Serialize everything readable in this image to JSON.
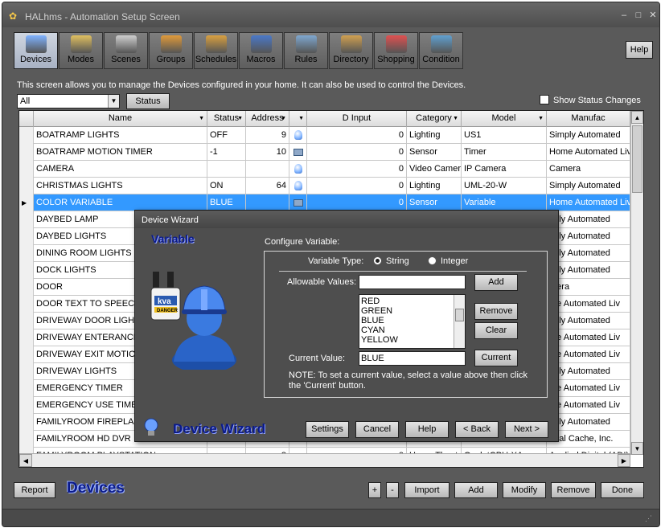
{
  "window": {
    "title": "HALhms - Automation Setup Screen",
    "controls": [
      "–",
      "□",
      "✕"
    ]
  },
  "toolbar": {
    "buttons": [
      {
        "label": "Devices",
        "icon": "bulb-icon",
        "color": "#7fb3ff"
      },
      {
        "label": "Modes",
        "icon": "house-icon",
        "color": "#e0c060"
      },
      {
        "label": "Scenes",
        "icon": "clapperboard-icon",
        "color": "#cfcfcf"
      },
      {
        "label": "Groups",
        "icon": "circles-icon",
        "color": "#e09a3a"
      },
      {
        "label": "Schedules",
        "icon": "calendar-icon",
        "color": "#d9a040"
      },
      {
        "label": "Macros",
        "icon": "funnel-icon",
        "color": "#4a78c8"
      },
      {
        "label": "Rules",
        "icon": "rules-icon",
        "color": "#7fa8d0"
      },
      {
        "label": "Directory",
        "icon": "people-icon",
        "color": "#d0a050"
      },
      {
        "label": "Shopping",
        "icon": "cart-icon",
        "color": "#e05050"
      },
      {
        "label": "Condition",
        "icon": "condition-icon",
        "color": "#60a0d0"
      }
    ],
    "help_label": "Help"
  },
  "main": {
    "description": "This screen allows you to manage the Devices configured in your home. It can also be used to control the Devices.",
    "filter_value": "All",
    "status_button": "Status",
    "show_status_changes": "Show Status Changes"
  },
  "grid": {
    "columns": [
      "Name",
      "Status",
      "Address",
      "",
      "D Input",
      "Category",
      "Model",
      "Manufac"
    ],
    "rows": [
      {
        "name": "BOATRAMP LIGHTS",
        "status": "OFF",
        "address": "9",
        "icon": "bulb",
        "dinput": "0",
        "category": "Lighting",
        "model": "US1",
        "manufacturer": "Simply Automated"
      },
      {
        "name": "BOATRAMP MOTION TIMER",
        "status": "-1",
        "address": "10",
        "icon": "cam",
        "dinput": "0",
        "category": "Sensor",
        "model": "Timer",
        "manufacturer": "Home Automated Liv"
      },
      {
        "name": "CAMERA",
        "status": "",
        "address": "",
        "icon": "bulb",
        "dinput": "0",
        "category": "Video Camer",
        "model": "IP Camera",
        "manufacturer": "Camera"
      },
      {
        "name": "CHRISTMAS LIGHTS",
        "status": "ON",
        "address": "64",
        "icon": "bulb",
        "dinput": "0",
        "category": "Lighting",
        "model": "UML-20-W",
        "manufacturer": "Simply Automated"
      },
      {
        "name": "COLOR VARIABLE",
        "status": "BLUE",
        "address": "",
        "icon": "cam",
        "dinput": "0",
        "category": "Sensor",
        "model": "Variable",
        "manufacturer": "Home Automated Liv",
        "selected": true
      },
      {
        "name": "DAYBED LAMP",
        "status": "",
        "address": "",
        "icon": "",
        "dinput": "",
        "category": "",
        "model": "",
        "manufacturer": "nply Automated"
      },
      {
        "name": "DAYBED LIGHTS",
        "status": "",
        "address": "",
        "icon": "",
        "dinput": "",
        "category": "",
        "model": "",
        "manufacturer": "nply Automated"
      },
      {
        "name": "DINING ROOM LIGHTS",
        "status": "",
        "address": "",
        "icon": "",
        "dinput": "",
        "category": "",
        "model": "",
        "manufacturer": "nply Automated"
      },
      {
        "name": "DOCK LIGHTS",
        "status": "",
        "address": "",
        "icon": "",
        "dinput": "",
        "category": "",
        "model": "",
        "manufacturer": "nply Automated"
      },
      {
        "name": "DOOR",
        "status": "",
        "address": "",
        "icon": "",
        "dinput": "",
        "category": "",
        "model": "",
        "manufacturer": "mera"
      },
      {
        "name": "DOOR TEXT TO SPEECH I",
        "status": "",
        "address": "",
        "icon": "",
        "dinput": "",
        "category": "",
        "model": "",
        "manufacturer": "me Automated Liv"
      },
      {
        "name": "DRIVEWAY DOOR LIGHTS",
        "status": "",
        "address": "",
        "icon": "",
        "dinput": "",
        "category": "",
        "model": "",
        "manufacturer": "nply Automated"
      },
      {
        "name": "DRIVEWAY ENTERANCE N",
        "status": "",
        "address": "",
        "icon": "",
        "dinput": "",
        "category": "",
        "model": "",
        "manufacturer": "me Automated Liv"
      },
      {
        "name": "DRIVEWAY EXIT MOTION",
        "status": "",
        "address": "",
        "icon": "",
        "dinput": "",
        "category": "",
        "model": "",
        "manufacturer": "me Automated Liv"
      },
      {
        "name": "DRIVEWAY LIGHTS",
        "status": "",
        "address": "",
        "icon": "",
        "dinput": "",
        "category": "",
        "model": "",
        "manufacturer": "nply Automated"
      },
      {
        "name": "EMERGENCY TIMER",
        "status": "",
        "address": "",
        "icon": "",
        "dinput": "",
        "category": "",
        "model": "",
        "manufacturer": "me Automated Liv"
      },
      {
        "name": "EMERGENCY USE TIMER F",
        "status": "",
        "address": "",
        "icon": "",
        "dinput": "",
        "category": "",
        "model": "",
        "manufacturer": "me Automated Liv"
      },
      {
        "name": "FAMILYROOM FIREPLACE",
        "status": "",
        "address": "",
        "icon": "",
        "dinput": "",
        "category": "",
        "model": "",
        "manufacturer": "nply Automated"
      },
      {
        "name": "FAMILYROOM HD DVR",
        "status": "",
        "address": "",
        "icon": "",
        "dinput": "",
        "category": "",
        "model": "",
        "manufacturer": "obal Cache, Inc."
      },
      {
        "name": "FAMILYROOM PLAYSTATION",
        "status": "",
        "address": "8",
        "icon": "",
        "dinput": "0",
        "category": "Home Theate",
        "model": "OcelotCPU-XA",
        "manufacturer": "Applied Digital (ADI)"
      }
    ]
  },
  "bottom": {
    "report": "Report",
    "section_title": "Devices",
    "plus": "+",
    "minus": "-",
    "import": "Import",
    "add": "Add",
    "modify": "Modify",
    "remove": "Remove",
    "done": "Done"
  },
  "wizard": {
    "title": "Device Wizard",
    "heading": "Variable",
    "configure_label": "Configure Variable:",
    "variable_type_label": "Variable Type:",
    "type_string": "String",
    "type_integer": "Integer",
    "allowable_label": "Allowable Values:",
    "allowable_input": "",
    "values": [
      "RED",
      "GREEN",
      "BLUE",
      "CYAN",
      "YELLOW"
    ],
    "add": "Add",
    "remove": "Remove",
    "clear": "Clear",
    "current_label": "Current Value:",
    "current_value": "BLUE",
    "current_button": "Current",
    "note": "NOTE: To set a current value, select a value above then click the 'Current' button.",
    "footer_title": "Device Wizard",
    "settings": "Settings",
    "cancel": "Cancel",
    "help": "Help",
    "back": "< Back",
    "next": "Next >",
    "art_label": "kva",
    "art_warning": "DANGER"
  }
}
